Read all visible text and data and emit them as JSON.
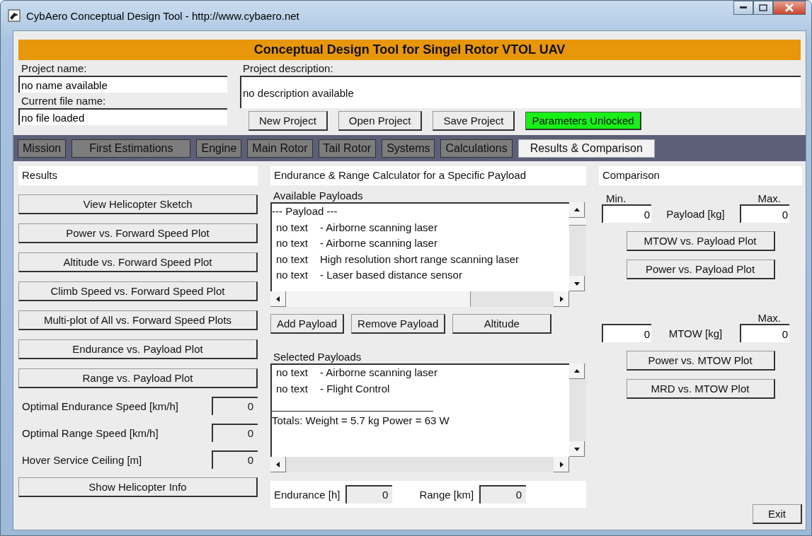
{
  "window": {
    "title": "CybAero Conceptual Design Tool - http://www.cybaero.net"
  },
  "header": {
    "title": "Conceptual Design Tool for Singel Rotor VTOL UAV"
  },
  "project": {
    "name_label": "Project name:",
    "name_value": "no name available",
    "file_label": "Current file name:",
    "file_value": "no file loaded",
    "description_label": "Project description:",
    "description_value": "no description available"
  },
  "project_buttons": [
    "New Project",
    "Open Project",
    "Save Project"
  ],
  "lock_status": {
    "label": "Parameters Unlocked",
    "unlocked": true
  },
  "tabs": [
    {
      "label": "Mission",
      "selected": false
    },
    {
      "label": "First Estimations",
      "selected": false
    },
    {
      "label": "Engine",
      "selected": false
    },
    {
      "label": "Main Rotor",
      "selected": false
    },
    {
      "label": "Tail Rotor",
      "selected": false
    },
    {
      "label": "Systems",
      "selected": false
    },
    {
      "label": "Calculations",
      "selected": false
    },
    {
      "label": "Results & Comparison",
      "selected": true
    }
  ],
  "results": {
    "title": "Results",
    "plot_buttons": [
      "View Helicopter Sketch",
      "Power vs. Forward Speed Plot",
      "Altitude vs. Forward Speed Plot",
      "Climb Speed vs. Forward Speed Plot",
      "Multi-plot of All vs. Forward Speed Plots",
      "Endurance vs. Payload Plot",
      "Range vs. Payload Plot"
    ],
    "readouts": [
      {
        "label": "Optimal Endurance Speed [km/h]",
        "value": "0"
      },
      {
        "label": "Optimal Range Speed [km/h]",
        "value": "0"
      },
      {
        "label": "Hover Service Ceiling [m]",
        "value": "0"
      }
    ],
    "info_button": "Show Helicopter Info"
  },
  "calculator": {
    "title": "Endurance & Range Calculator for a Specific Payload",
    "available_label": "Available Payloads",
    "available_header": "---  Payload  ---",
    "available_items": [
      {
        "code": "no text",
        "name": "-  Airborne scanning laser"
      },
      {
        "code": "no text",
        "name": "-  Airborne scanning laser"
      },
      {
        "code": "no text",
        "name": "High resolution short range scanning laser"
      },
      {
        "code": "no text",
        "name": "-  Laser based distance sensor"
      }
    ],
    "actions": [
      "Add Payload",
      "Remove Payload",
      "Altitude"
    ],
    "selected_label": "Selected Payloads",
    "selected_items": [
      {
        "code": "no text",
        "name": "-  Airborne scanning laser"
      },
      {
        "code": "no text",
        "name": "-  Flight Control"
      }
    ],
    "totals": "Totals:   Weight = 5.7 kg    Power = 63 W",
    "endurance": {
      "label": "Endurance [h]",
      "value": "0"
    },
    "range": {
      "label": "Range [km]",
      "value": "0"
    }
  },
  "comparison": {
    "title": "Comparison",
    "payload": {
      "min_label": "Min.",
      "max_label": "Max.",
      "min_value": "0",
      "label": "Payload [kg]",
      "max_value": "0"
    },
    "payload_buttons": [
      "MTOW vs. Payload Plot",
      "Power vs. Payload Plot"
    ],
    "mtow": {
      "max_label": "Max.",
      "min_value": "0",
      "label": "MTOW [kg]",
      "max_value": "0"
    },
    "mtow_buttons": [
      "Power vs. MTOW Plot",
      "MRD vs. MTOW Plot"
    ],
    "exit_button": "Exit"
  }
}
